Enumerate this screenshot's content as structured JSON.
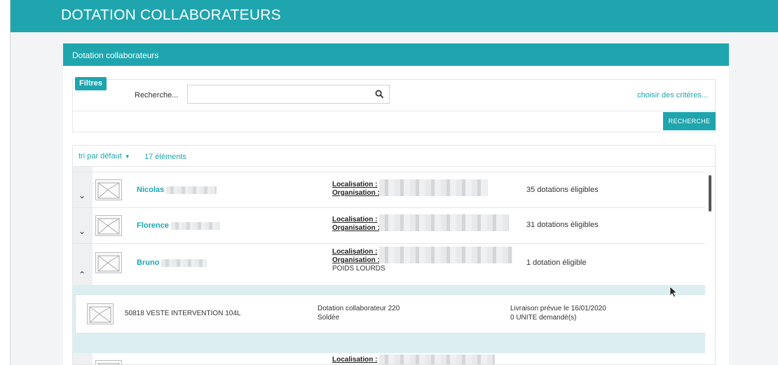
{
  "app": {
    "title": "DOTATION COLLABORATEURS"
  },
  "panel": {
    "header": "Dotation collaborateurs"
  },
  "filters": {
    "badge": "Filtres",
    "search_label": "Recherche...",
    "search_value": "",
    "criteria_link": "choisir des critères...",
    "search_button": "RECHERCHE"
  },
  "results": {
    "sort_label": "tri par défaut",
    "count": "17 éléments",
    "location_label": "Localisation :",
    "organisation_label": "Organisation :",
    "rows": [
      {
        "name": "Nicolas",
        "eligible": "35 dotations éligibles",
        "expanded": false
      },
      {
        "name": "Florence",
        "eligible": "31 dotations éligibles",
        "expanded": false
      },
      {
        "name": "Bruno",
        "eligible": "1 dotation éligible",
        "expanded": true,
        "extra": "POIDS LOURDS"
      }
    ],
    "detail": {
      "article": "50818 VESTE INTERVENTION 104L",
      "dotation": "Dotation collaborateur 220",
      "status": "Soldée",
      "delivery": "Livraison prévue le 16/01/2020",
      "quantity": "0 UNITE demandé(s)"
    }
  },
  "colors": {
    "accent": "#1ea5ae",
    "detail_bg": "#dceef1"
  }
}
